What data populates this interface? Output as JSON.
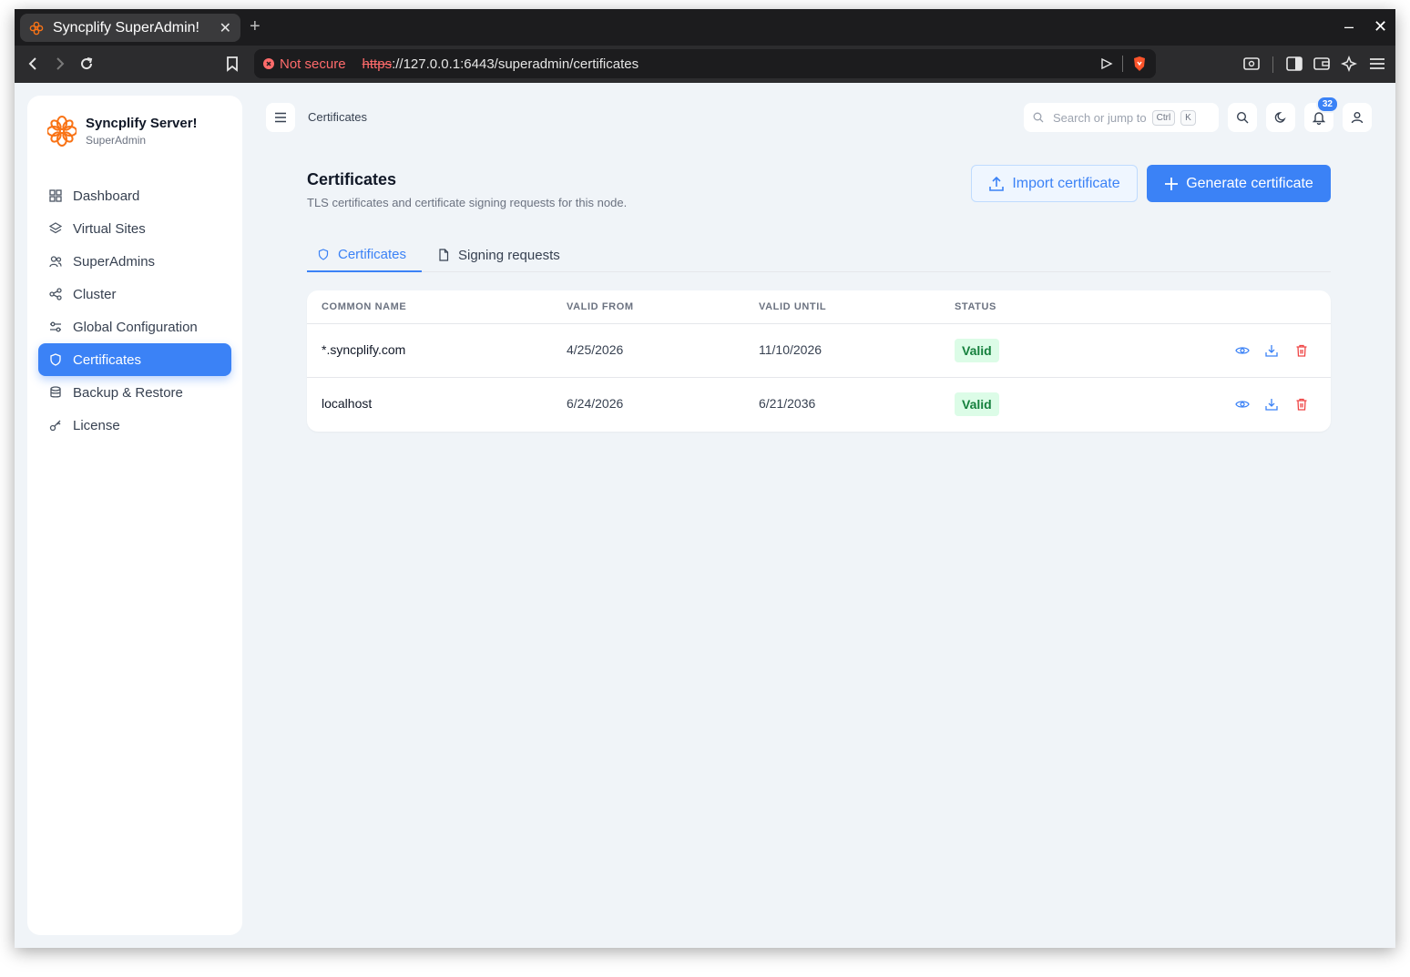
{
  "browser": {
    "tab_title": "Syncplify SuperAdmin!",
    "security_label": "Not secure",
    "url_scheme": "https",
    "url_rest": "://127.0.0.1:6443/superadmin/certificates"
  },
  "brand": {
    "name": "Syncplify Server!",
    "subtitle": "SuperAdmin",
    "accent": "#f97316"
  },
  "sidebar": {
    "items": [
      {
        "label": "Dashboard",
        "icon": "grid-icon"
      },
      {
        "label": "Virtual Sites",
        "icon": "layers-icon"
      },
      {
        "label": "SuperAdmins",
        "icon": "users-icon"
      },
      {
        "label": "Cluster",
        "icon": "share-icon"
      },
      {
        "label": "Global Configuration",
        "icon": "sliders-icon"
      },
      {
        "label": "Certificates",
        "icon": "shield-icon",
        "active": true
      },
      {
        "label": "Backup & Restore",
        "icon": "database-icon"
      },
      {
        "label": "License",
        "icon": "key-icon"
      }
    ]
  },
  "topbar": {
    "breadcrumb": "Certificates",
    "search_placeholder": "Search or jump to",
    "kbd_ctrl": "Ctrl",
    "kbd_k": "K",
    "notification_count": "32"
  },
  "page": {
    "title": "Certificates",
    "subtitle": "TLS certificates and certificate signing requests for this node.",
    "import_label": "Import certificate",
    "generate_label": "Generate certificate",
    "tabs": [
      {
        "label": "Certificates",
        "active": true
      },
      {
        "label": "Signing requests",
        "active": false
      }
    ]
  },
  "table": {
    "headers": [
      "COMMON NAME",
      "VALID FROM",
      "VALID UNTIL",
      "STATUS"
    ],
    "rows": [
      {
        "common_name": "*.syncplify.com",
        "valid_from": "4/25/2026",
        "valid_until": "11/10/2026",
        "status": "Valid"
      },
      {
        "common_name": "localhost",
        "valid_from": "6/24/2026",
        "valid_until": "6/21/2036",
        "status": "Valid"
      }
    ]
  },
  "colors": {
    "primary": "#3b82f6",
    "danger": "#ef4444",
    "success_bg": "#dcfce7",
    "success_text": "#15803d"
  }
}
